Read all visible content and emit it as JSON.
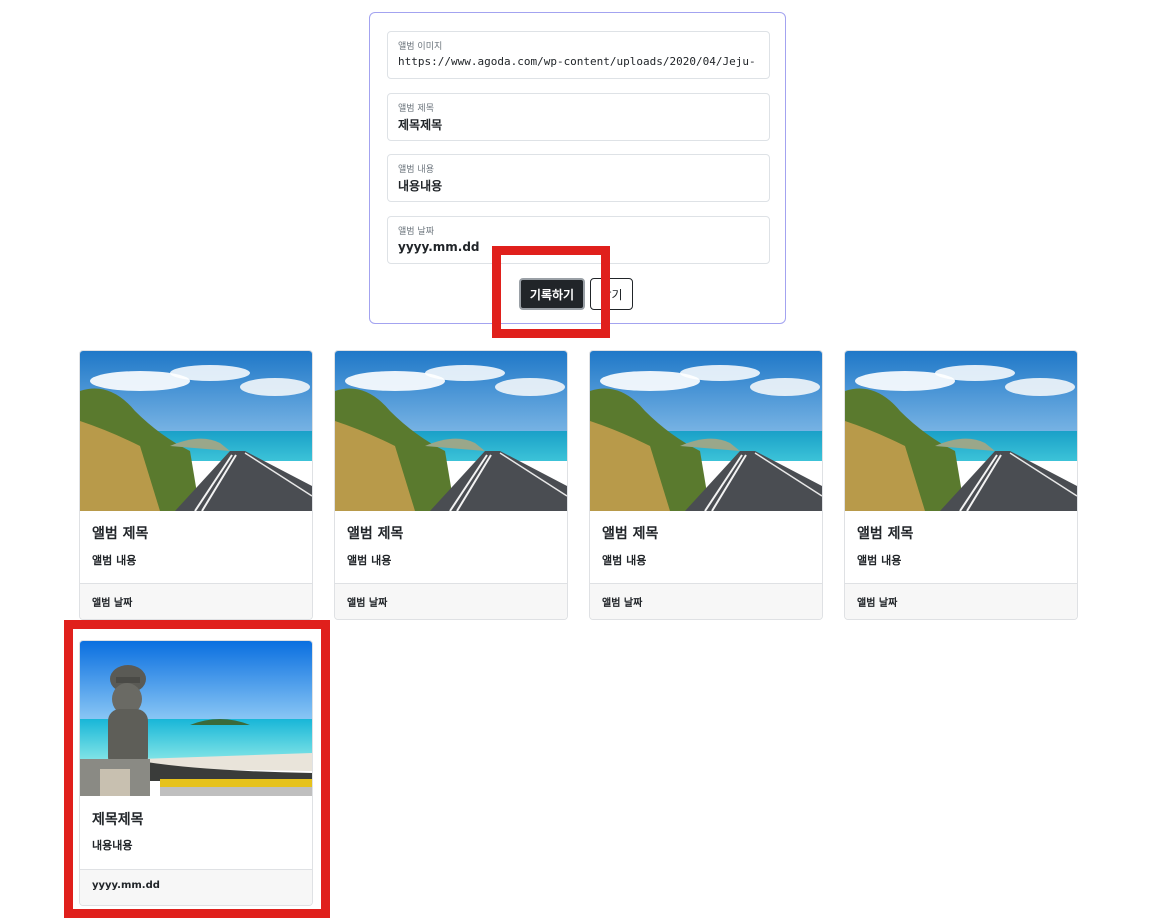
{
  "form": {
    "image_label": "앨범 이미지",
    "image_value": "https://www.agoda.com/wp-content/uploads/2020/04/Jeju-",
    "title_label": "앨범 제목",
    "title_value": "제목제목",
    "content_label": "앨범 내용",
    "content_value": "내용내용",
    "date_label": "앨범 날짜",
    "date_value": "yyyy.mm.dd",
    "record_button": "기록하기",
    "close_button": "닫기"
  },
  "cards": [
    {
      "title": "앨범 제목",
      "content": "앨범 내용",
      "date": "앨범 날짜",
      "image": "coastal-road-photo"
    },
    {
      "title": "앨범 제목",
      "content": "앨범 내용",
      "date": "앨범 날짜",
      "image": "coastal-road-photo"
    },
    {
      "title": "앨범 제목",
      "content": "앨범 내용",
      "date": "앨범 날짜",
      "image": "coastal-road-photo"
    },
    {
      "title": "앨범 제목",
      "content": "앨범 내용",
      "date": "앨범 날짜",
      "image": "coastal-road-photo"
    },
    {
      "title": "제목제목",
      "content": "내용내용",
      "date": "yyyy.mm.dd",
      "image": "jeju-stone-statue-beach-photo"
    }
  ],
  "colors": {
    "highlight": "#e0201c",
    "panel_border": "#a3a3f0",
    "primary_button": "#212529"
  }
}
